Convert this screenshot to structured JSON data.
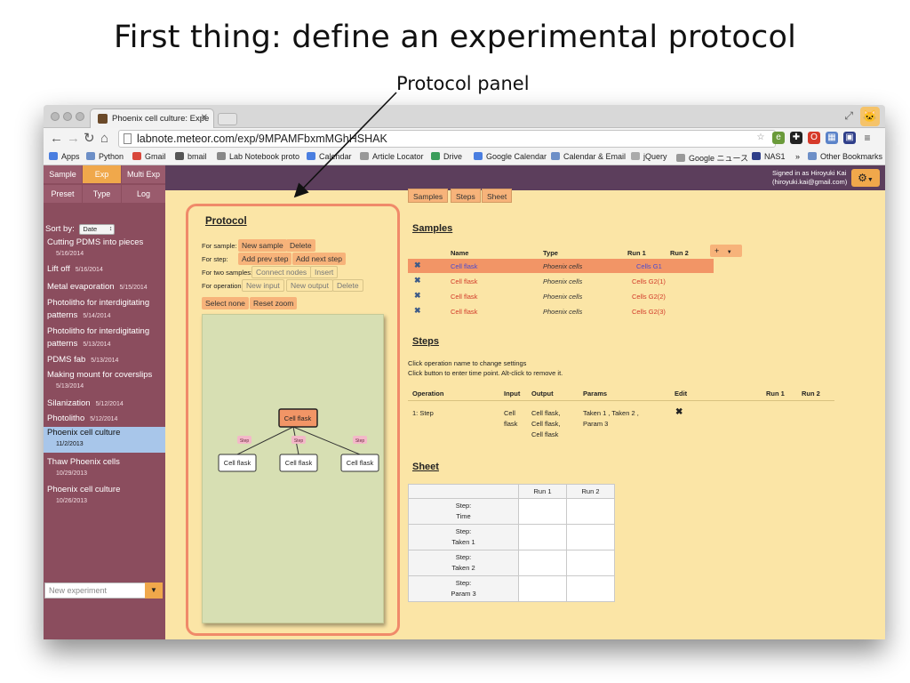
{
  "slide": {
    "title": "First thing: define an experimental protocol",
    "callout": "Protocol panel"
  },
  "browser": {
    "tab_title": "Phoenix cell culture: Expe",
    "url": "labnote.meteor.com/exp/9MPAMFbxmMGhHSHAK",
    "bookmarks": [
      "Apps",
      "Python",
      "Gmail",
      "bmail",
      "Lab Notebook proto",
      "Calendar",
      "Article Locator",
      "Drive",
      "Google Calendar",
      "Calendar & Email",
      "jQuery",
      "Google ニュース",
      "NAS1",
      "»",
      "Other Bookmarks"
    ]
  },
  "sidebar": {
    "tabs": [
      "Sample",
      "Exp",
      "Multi Exp",
      "Preset",
      "Type",
      "Log"
    ],
    "active_tab": "Exp",
    "sort_label": "Sort by:",
    "sort_value": "Date",
    "experiments": [
      {
        "name": "Cutting PDMS into pieces",
        "date": "5/16/2014"
      },
      {
        "name": "Lift off",
        "date": "5/16/2014"
      },
      {
        "name": "Metal evaporation",
        "date": "5/15/2014"
      },
      {
        "name": "Photolitho for interdigitating patterns",
        "date": "5/14/2014"
      },
      {
        "name": "Photolitho for interdigitating patterns",
        "date": "5/13/2014"
      },
      {
        "name": "PDMS fab",
        "date": "5/13/2014"
      },
      {
        "name": "Making mount for coverslips",
        "date": "5/13/2014"
      },
      {
        "name": "Silanization",
        "date": "5/12/2014"
      },
      {
        "name": "Photolitho",
        "date": "5/12/2014"
      },
      {
        "name": "Phoenix cell culture",
        "date": "11/2/2013"
      },
      {
        "name": "Thaw Phoenix cells",
        "date": "10/29/2013"
      },
      {
        "name": "Phoenix cell culture",
        "date": "10/26/2013"
      }
    ],
    "new_experiment_placeholder": "New experiment"
  },
  "topbar": {
    "signed_in_line1": "Signed in as Hiroyuki Kai",
    "signed_in_line2": "(hiroyuki.kai@gmail.com)"
  },
  "protocol": {
    "title": "Protocol",
    "rows": [
      {
        "label": "For sample:",
        "buttons": [
          "New sample",
          "Delete"
        ]
      },
      {
        "label": "For step:",
        "buttons": [
          "Add prev step",
          "Add next step"
        ]
      },
      {
        "label": "For two samples:",
        "buttons": [
          "Connect nodes",
          "Insert"
        ]
      },
      {
        "label": "For operation:",
        "buttons": [
          "New input",
          "New output",
          "Delete"
        ]
      }
    ],
    "bottom_buttons": [
      "Select none",
      "Reset zoom"
    ],
    "graph": {
      "root": "Cell flask",
      "edge_label": "Step",
      "children": [
        "Cell flask",
        "Cell flask",
        "Cell flask"
      ]
    }
  },
  "section_tabs": [
    "Samples",
    "Steps",
    "Sheet"
  ],
  "samples": {
    "title": "Samples",
    "headers": [
      "Name",
      "Type",
      "Run 1",
      "Run 2"
    ],
    "add_button": "+",
    "rows": [
      {
        "name": "Cell flask",
        "type": "Phoenix cells",
        "run1": "Cells G1"
      },
      {
        "name": "Cell flask",
        "type": "Phoenix cells",
        "run1": "Cells G2(1)"
      },
      {
        "name": "Cell flask",
        "type": "Phoenix cells",
        "run1": "Cells G2(2)"
      },
      {
        "name": "Cell flask",
        "type": "Phoenix cells",
        "run1": "Cells G2(3)"
      }
    ]
  },
  "steps": {
    "title": "Steps",
    "hint1": "Click operation name to change settings",
    "hint2": "Click button to enter time point. Alt-click to remove it.",
    "headers": [
      "Operation",
      "Input",
      "Output",
      "Params",
      "Edit",
      "Run 1",
      "Run 2"
    ],
    "row": {
      "operation": "1:  Step",
      "input_1": "Cell",
      "input_2": "flask",
      "output_1": "Cell flask,",
      "output_2": "Cell flask,",
      "output_3": "Cell flask",
      "params_1": "Taken 1 , Taken 2 ,",
      "params_2": "Param 3"
    }
  },
  "sheet": {
    "title": "Sheet",
    "headers": [
      "Run 1",
      "Run 2"
    ],
    "rows": [
      {
        "line1": "Step:",
        "line2": "Time"
      },
      {
        "line1": "Step:",
        "line2": "Taken 1"
      },
      {
        "line1": "Step:",
        "line2": "Taken 2"
      },
      {
        "line1": "Step:",
        "line2": "Param 3"
      }
    ]
  },
  "colors": {
    "sidebar": "#8b4d5e",
    "accent_orange": "#f0a84b",
    "page_bg": "#fbe5a6",
    "topbar": "#5c3e5c",
    "selected_row": "#f29566",
    "panel_outline": "#f08a6a",
    "canvas_bg": "#d7dfb3"
  }
}
